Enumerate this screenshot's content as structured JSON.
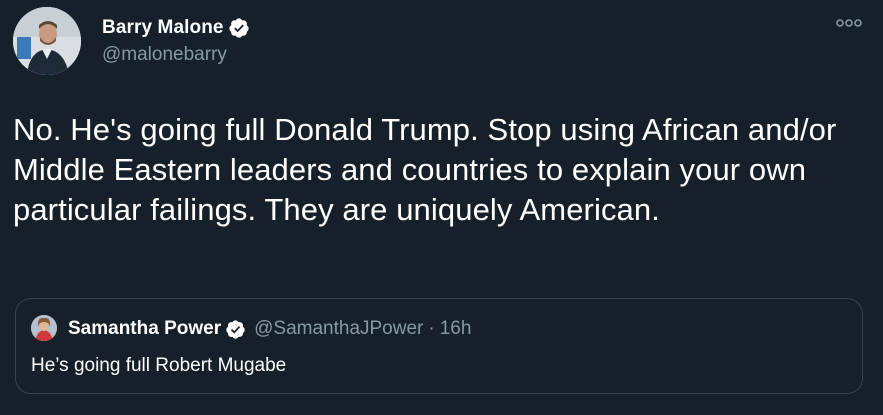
{
  "tweet": {
    "author": {
      "display_name": "Barry Malone",
      "handle": "@malonebarry",
      "verified": true
    },
    "more_icon": "more-options-icon",
    "text": "No. He's going full Donald Trump. Stop using African and/or Middle Eastern leaders and countries to explain your own particular failings. They are uniquely American.",
    "quoted_tweet": {
      "display_name": "Samantha Power",
      "handle": "@SamanthaJPower",
      "separator": "·",
      "timestamp": "16h",
      "verified": true,
      "text": "He’s going full Robert Mugabe"
    }
  },
  "colors": {
    "background": "#15202b",
    "text": "#ffffff",
    "secondary_text": "#8899a6",
    "border": "#38444d",
    "verified_badge": "#ffffff"
  }
}
